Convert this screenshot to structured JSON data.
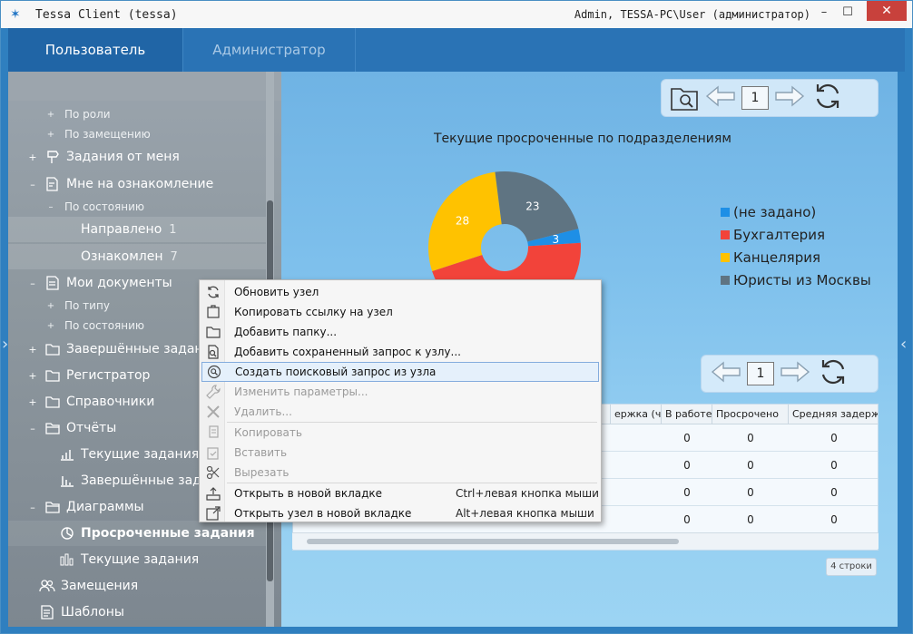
{
  "window": {
    "title": "Tessa Client (tessa)",
    "user_info": "Admin, TESSA-PC\\User (администратор)",
    "minimize_label": "–",
    "maximize_label": "☐",
    "close_label": "✕"
  },
  "nav": {
    "tabs": [
      {
        "label": "Пользователь"
      },
      {
        "label": "Администратор"
      }
    ]
  },
  "sidebar": {
    "items": {
      "po_roli": "По роли",
      "po_zamesheniyu": "По замещению",
      "zadaniya_ot_menya": "Задания от меня",
      "mne_na_oznakomlenie": "Мне на ознакомление",
      "po_sostoyaniyu_1": "По состоянию",
      "napravleno": "Направлено",
      "napravleno_count": "1",
      "oznakomlen": "Ознакомлен",
      "oznakomlen_count": "7",
      "moi_dokumenty": "Мои документы",
      "po_tipu": "По типу",
      "po_sostoyaniyu_2": "По состоянию",
      "zavershennye_zadaniya": "Завершённые задания",
      "registrator": "Регистратор",
      "spravochniki": "Справочники",
      "otchety": "Отчёты",
      "tekushchie_zadaniya_1": "Текущие задания",
      "zavershennye_zadan": "Завершённые задан",
      "diagrammy": "Диаграммы",
      "prosrochennye_zadaniya": "Просроченные задания",
      "tekushchie_zadaniya_2": "Текущие задания",
      "zamesheniya": "Замещения",
      "shablony": "Шаблоны"
    }
  },
  "chart_pager": {
    "page": "1"
  },
  "grid_pager": {
    "page": "1"
  },
  "chart_data": {
    "type": "pie",
    "title": "Текущие просроченные по подразделениям",
    "donut": true,
    "series": [
      {
        "name": "(не задано)",
        "value": 3,
        "color": "#1e8fe6"
      },
      {
        "name": "Бухгалтерия",
        "value": 46,
        "color": "#f2433a"
      },
      {
        "name": "Канцелярия",
        "value": 28,
        "color": "#ffc200"
      },
      {
        "name": "Юристы из Москвы",
        "value": 23,
        "color": "#5f7482"
      }
    ],
    "labels_shown": [
      "28",
      "23",
      "3"
    ],
    "legend_position": "right"
  },
  "grid": {
    "columns": [
      "ержка (ч)",
      "В работе",
      "Просрочено",
      "Средняя задержка (ч"
    ],
    "rows": [
      [
        "0",
        "0",
        "0"
      ],
      [
        "0",
        "0",
        "0"
      ],
      [
        "0",
        "0",
        "0"
      ],
      [
        "0",
        "0",
        "0"
      ]
    ],
    "row_count": "4 строки"
  },
  "context_menu": {
    "items": [
      {
        "label": "Обновить узел",
        "shortcut": "",
        "disabled": false,
        "icon": "refresh-icon"
      },
      {
        "label": "Копировать ссылку на узел",
        "shortcut": "",
        "disabled": false,
        "icon": "link-icon"
      },
      {
        "label": "Добавить папку...",
        "shortcut": "",
        "disabled": false,
        "icon": "folder-icon"
      },
      {
        "label": "Добавить сохраненный запрос к узлу...",
        "shortcut": "",
        "disabled": false,
        "icon": "saved-query-icon"
      },
      {
        "label": "Создать поисковый запрос из узла",
        "shortcut": "",
        "disabled": false,
        "icon": "search-icon"
      },
      {
        "label": "Изменить параметры...",
        "shortcut": "",
        "disabled": true,
        "icon": "wrench-icon"
      },
      {
        "label": "Удалить...",
        "shortcut": "",
        "disabled": true,
        "icon": "delete-icon"
      },
      {
        "label": "Копировать",
        "shortcut": "",
        "disabled": true,
        "icon": "copy-icon"
      },
      {
        "label": "Вставить",
        "shortcut": "",
        "disabled": true,
        "icon": "paste-icon"
      },
      {
        "label": "Вырезать",
        "shortcut": "",
        "disabled": true,
        "icon": "scissors-icon"
      },
      {
        "label": "Открыть в новой вкладке",
        "shortcut": "Ctrl+левая кнопка мыши",
        "disabled": false,
        "icon": "open-tab-icon"
      },
      {
        "label": "Открыть узел в новой вкладке",
        "shortcut": "Alt+левая кнопка мыши",
        "disabled": false,
        "icon": "open-node-icon"
      }
    ]
  }
}
